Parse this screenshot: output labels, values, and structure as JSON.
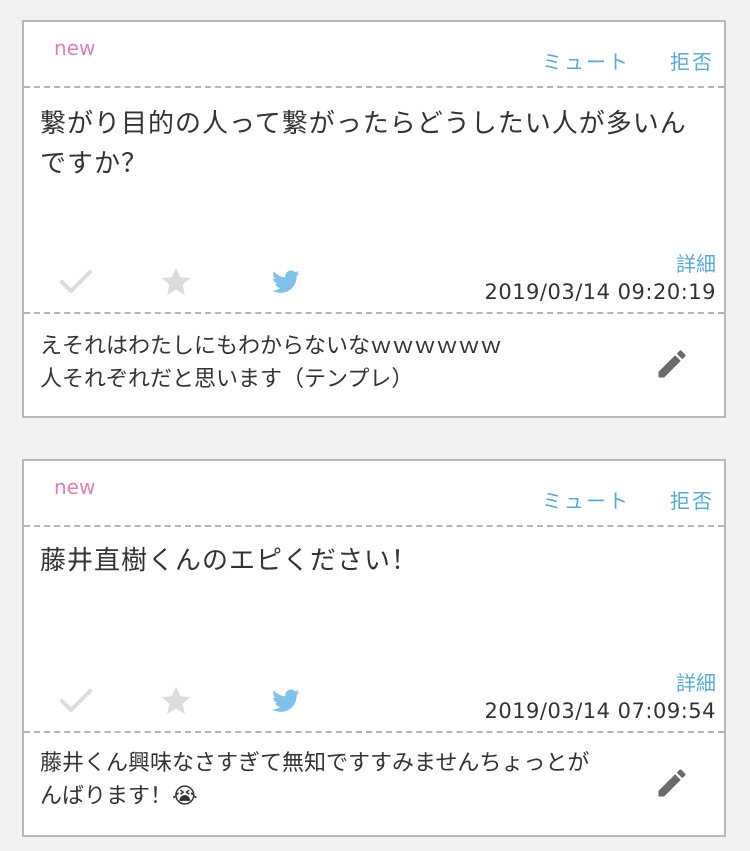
{
  "colors": {
    "new_badge": "#e07fb4",
    "link": "#55aadc",
    "icon_inactive": "#dcdcdc",
    "twitter": "#7fc1ea",
    "border": "#b8b8b8"
  },
  "cards": [
    {
      "badge": "new",
      "mute_label": "ミュート",
      "reject_label": "拒否",
      "question": "繋がり目的の人って繋がったらどうしたい人が多いんですか？",
      "detail_label": "詳細",
      "icons": [
        "check-icon",
        "star-icon",
        "twitter-icon"
      ],
      "timestamp": "2019/03/14 09:20:19",
      "answer": "えそれはわたしにもわからないなｗｗｗｗｗｗ\n人それぞれだと思います（テンプレ）",
      "edit_icon": "pencil-icon"
    },
    {
      "badge": "new",
      "mute_label": "ミュート",
      "reject_label": "拒否",
      "question": "藤井直樹くんのエピください！",
      "detail_label": "詳細",
      "icons": [
        "check-icon",
        "star-icon",
        "twitter-icon"
      ],
      "timestamp": "2019/03/14 07:09:54",
      "answer": "藤井くん興味なさすぎて無知ですすみませんちょっとがんばります！😭",
      "edit_icon": "pencil-icon"
    }
  ]
}
